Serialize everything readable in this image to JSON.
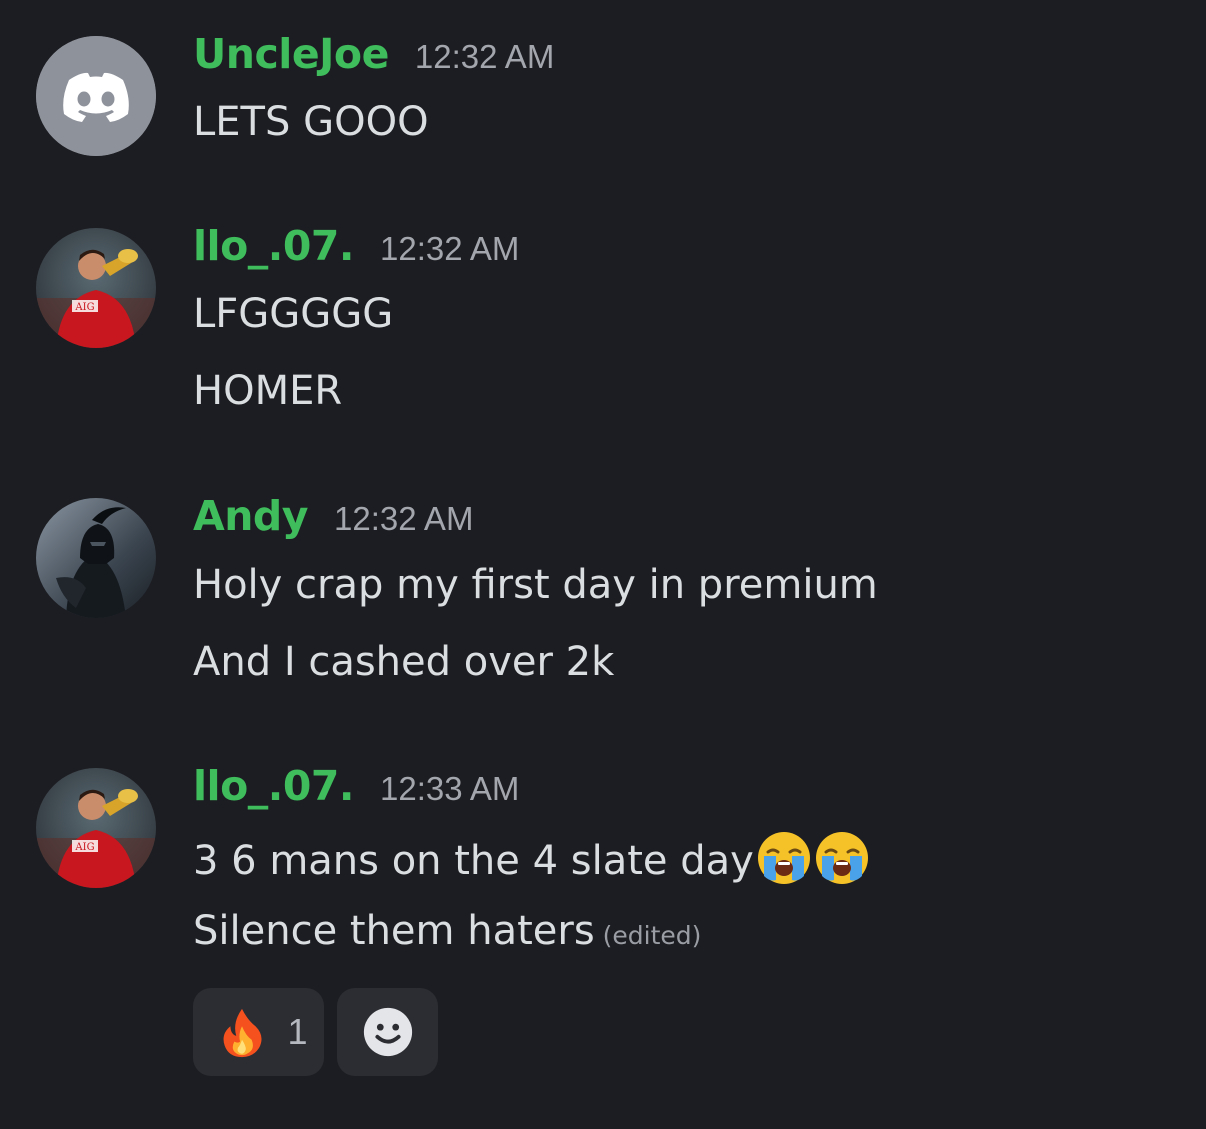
{
  "messages": [
    {
      "username": "UncleJoe",
      "timestamp": "12:32 AM",
      "avatar": "discord-default-avatar",
      "lines": [
        "LETS GOOO"
      ]
    },
    {
      "username": "llo_.07.",
      "timestamp": "12:32 AM",
      "avatar": "footballer-avatar",
      "lines": [
        "LFGGGGG",
        "HOMER"
      ]
    },
    {
      "username": "Andy",
      "timestamp": "12:32 AM",
      "avatar": "spartan-avatar",
      "lines": [
        "Holy crap my first day in premium",
        "And I cashed over 2k"
      ]
    },
    {
      "username": "llo_.07.",
      "timestamp": "12:33 AM",
      "avatar": "footballer-avatar",
      "lines": [
        "3 6 mans on the 4 slate day",
        "Silence them haters"
      ],
      "line_emojis": [
        "loudly-crying-face-icon",
        "loudly-crying-face-icon"
      ],
      "edited_label": "(edited)",
      "reactions": [
        {
          "emoji": "fire-icon",
          "count": "1"
        },
        {
          "emoji": "add-reaction-icon"
        }
      ]
    }
  ],
  "colors": {
    "background": "#1c1d22",
    "username": "#3fbd5c",
    "message_text": "#dbdee1",
    "timestamp": "#a3a6ad",
    "reaction_bg": "#2b2d33"
  }
}
